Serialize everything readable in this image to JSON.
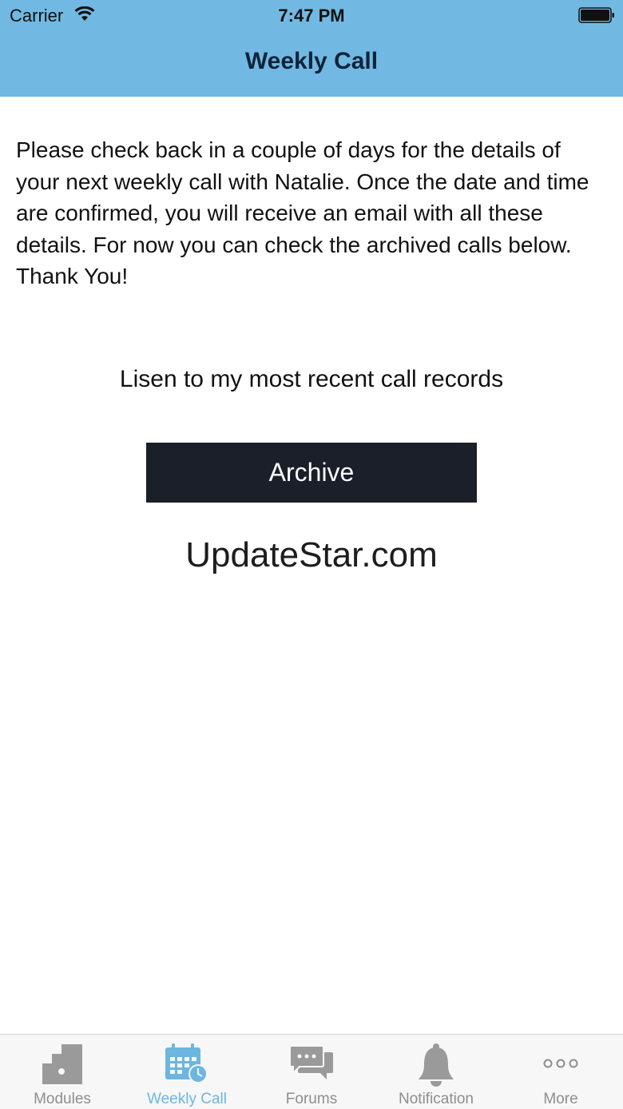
{
  "status": {
    "carrier": "Carrier",
    "time": "7:47 PM"
  },
  "nav": {
    "title": "Weekly Call"
  },
  "content": {
    "intro": "Please check back in a couple of days for the details of your next weekly call with Natalie. Once the date and time are confirmed, you will receive an email with all these details. For now you can check the archived calls below. Thank You!",
    "recent_label": "Lisen to my most recent call records",
    "archive_button": "Archive",
    "watermark": "UpdateStar.com"
  },
  "tabs": [
    {
      "label": "Modules",
      "icon": "puzzle-icon",
      "active": false
    },
    {
      "label": "Weekly Call",
      "icon": "calendar-clock-icon",
      "active": true
    },
    {
      "label": "Forums",
      "icon": "chat-bubbles-icon",
      "active": false
    },
    {
      "label": "Notification",
      "icon": "bell-icon",
      "active": false
    },
    {
      "label": "More",
      "icon": "more-dots-icon",
      "active": false
    }
  ],
  "colors": {
    "header": "#71b9e2",
    "active_tab": "#6cb6e0",
    "inactive_tab": "#8e8e8e",
    "button": "#1a1f2a"
  }
}
